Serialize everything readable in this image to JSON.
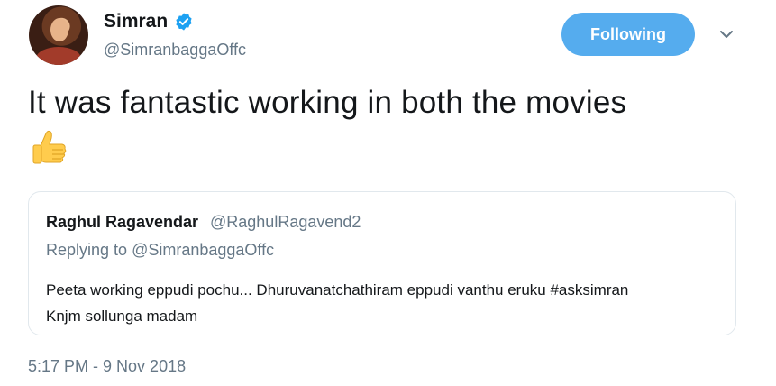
{
  "author": {
    "name": "Simran",
    "handle": "@SimranbaggaOffc",
    "verified": true
  },
  "follow_button": {
    "label": "Following"
  },
  "icons": {
    "verified": "verified-badge-icon",
    "caret": "chevron-down-icon",
    "emoji": "thumbs-up-icon"
  },
  "tweet": {
    "text": "It was fantastic working in both the movies",
    "emoji": "👍",
    "timestamp": "5:17 PM - 9 Nov 2018"
  },
  "quoted_tweet": {
    "name": "Raghul Ragavendar",
    "handle": "@RaghulRagavend2",
    "replying_label": "Replying to",
    "replying_to": "@SimranbaggaOffc",
    "line1": "Peeta working eppudi pochu... Dhuruvanatchathiram eppudi vanthu eruku #asksimran",
    "line2": "Knjm sollunga madam"
  },
  "colors": {
    "accent": "#55acee",
    "text": "#14171a",
    "secondary": "#657786",
    "border": "#e1e8ed",
    "verified": "#1da1f2"
  }
}
